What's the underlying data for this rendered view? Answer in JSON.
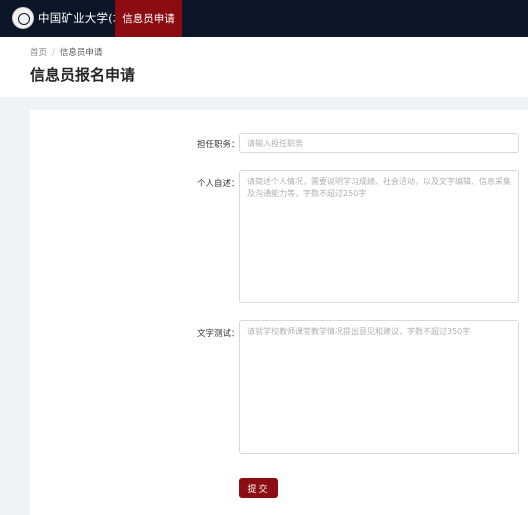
{
  "header": {
    "logo_text": "中国矿业大学(北京)",
    "active_tab": "信息员申请"
  },
  "breadcrumb": {
    "home": "首页",
    "separator": "/",
    "current": "信息员申请"
  },
  "page_title": "信息员报名申请",
  "form": {
    "position": {
      "label": "担任职务：",
      "value": "",
      "placeholder": "请输入担任职务"
    },
    "self_intro": {
      "label": "个人自述：",
      "value": "",
      "placeholder": "请简述个人情况，需要说明学习成绩、社会活动，以及文字编辑、信息采集及沟通能力等，字数不超过250字"
    },
    "writing_test": {
      "label": "文字测试：",
      "value": "",
      "placeholder": "请就学校教师课堂教学情况提出意见和建议，字数不超过350字"
    },
    "submit_label": "提交"
  },
  "colors": {
    "nav_background": "#0c1628",
    "accent": "#8b0c12",
    "page_background": "#f0f2f5"
  }
}
